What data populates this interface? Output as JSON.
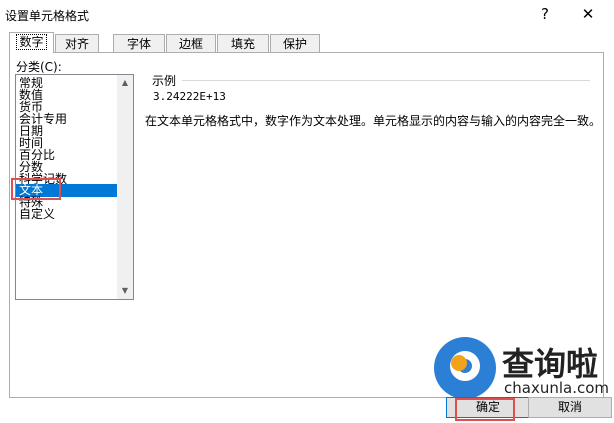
{
  "window": {
    "title": "设置单元格格式",
    "help_glyph": "?",
    "close_glyph": "✕"
  },
  "tabs": [
    {
      "label": "数字",
      "active": true
    },
    {
      "label": "对齐"
    },
    {
      "label": "字体"
    },
    {
      "label": "边框"
    },
    {
      "label": "填充"
    },
    {
      "label": "保护"
    }
  ],
  "category": {
    "label": "分类(C):",
    "items": [
      "常规",
      "数值",
      "货币",
      "会计专用",
      "日期",
      "时间",
      "百分比",
      "分数",
      "科学记数",
      "文本",
      "特殊",
      "自定义"
    ],
    "selected": "文本"
  },
  "sample": {
    "label": "示例",
    "value": "3.24222E+13"
  },
  "description": "在文本单元格格式中，数字作为文本处理。单元格显示的内容与输入的内容完全一致。",
  "buttons": {
    "ok": "确定",
    "cancel": "取消"
  },
  "watermark": {
    "text": "查询啦",
    "sub": "chaxunla.com"
  },
  "colors": {
    "selection": "#0078d7",
    "highlight": "#e04f4f",
    "watermark_blue": "#2b80d6",
    "watermark_orange": "#f2a31b"
  },
  "icons": {
    "scroll_up": "scroll-up-arrow-icon",
    "scroll_down": "scroll-down-arrow-icon"
  }
}
